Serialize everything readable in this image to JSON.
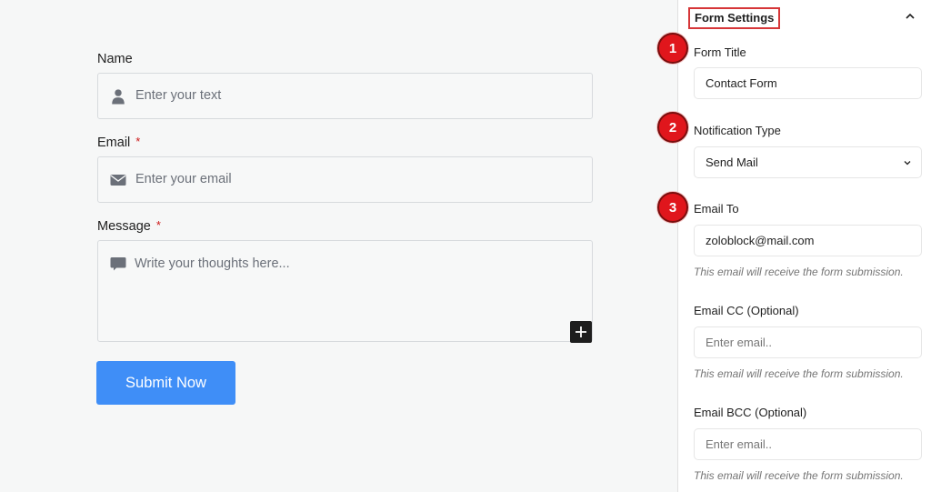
{
  "form_preview": {
    "fields": [
      {
        "label": "Name",
        "required": false,
        "placeholder": "Enter your text",
        "icon": "user-icon"
      },
      {
        "label": "Email",
        "required": true,
        "placeholder": "Enter your email",
        "icon": "envelope-icon"
      },
      {
        "label": "Message",
        "required": true,
        "placeholder": "Write your thoughts here...",
        "icon": "comment-icon"
      }
    ],
    "required_marker": "*",
    "add_block_icon": "plus-icon",
    "submit_label": "Submit Now",
    "submit_color": "#3f8ef7"
  },
  "settings_panel": {
    "title": "Form Settings",
    "collapse_icon": "chevron-up-icon",
    "form_title": {
      "label": "Form Title",
      "value": "Contact Form"
    },
    "notification_type": {
      "label": "Notification Type",
      "value": "Send Mail",
      "icon": "chevron-down-icon"
    },
    "email_to": {
      "label": "Email To",
      "value": "zoloblock@mail.com",
      "help": "This email will receive the form submission."
    },
    "email_cc": {
      "label": "Email CC (Optional)",
      "placeholder": "Enter email..",
      "help": "This email will receive the form submission."
    },
    "email_bcc": {
      "label": "Email BCC (Optional)",
      "placeholder": "Enter email..",
      "help": "This email will receive the form submission."
    }
  },
  "annotations": {
    "badges": [
      "1",
      "2",
      "3"
    ],
    "color": "#e0161c"
  }
}
